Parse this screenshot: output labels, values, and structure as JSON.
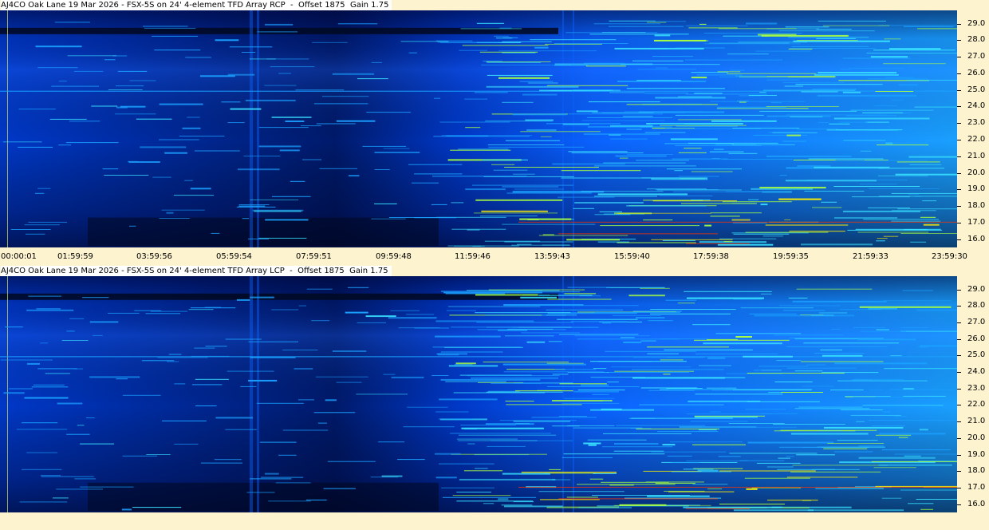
{
  "chart_data": [
    {
      "type": "heatmap",
      "title": "AJ4CO Oak Lane 19 Mar 2026 - FSX-5S on 24' 4-element TFD Array RCP  -  Offset 1875  Gain 1.75",
      "ylim": [
        15.5,
        29.8
      ],
      "yticks": [
        "16.0",
        "17.0",
        "18.0",
        "19.0",
        "20.0",
        "21.0",
        "22.0",
        "23.0",
        "24.0",
        "25.0",
        "26.0",
        "27.0",
        "28.0",
        "29.0"
      ],
      "xticks": [
        "00:00:01",
        "01:59:59",
        "03:59:56",
        "05:59:54",
        "07:59:51",
        "09:59:48",
        "11:59:46",
        "13:59:43",
        "15:59:40",
        "17:59:38",
        "19:59:35",
        "21:59:33",
        "23:59:30"
      ],
      "colorscale": [
        "#000820",
        "#001a6b",
        "#0038c8",
        "#0a62ff",
        "#1aa0ff",
        "#38e0ff",
        "#a8ff40",
        "#ffee00",
        "#ff3300"
      ]
    },
    {
      "type": "heatmap",
      "title": "AJ4CO Oak Lane 19 Mar 2026 - FSX-5S on 24' 4-element TFD Array LCP  -  Offset 1875  Gain 1.75",
      "ylim": [
        15.5,
        29.8
      ],
      "yticks": [
        "16.0",
        "17.0",
        "18.0",
        "19.0",
        "20.0",
        "21.0",
        "22.0",
        "23.0",
        "24.0",
        "25.0",
        "26.0",
        "27.0",
        "28.0",
        "29.0"
      ],
      "colorscale": [
        "#000820",
        "#001a6b",
        "#0038c8",
        "#0a62ff",
        "#1aa0ff",
        "#38e0ff",
        "#a8ff40",
        "#ffee00",
        "#ff3300"
      ]
    }
  ]
}
